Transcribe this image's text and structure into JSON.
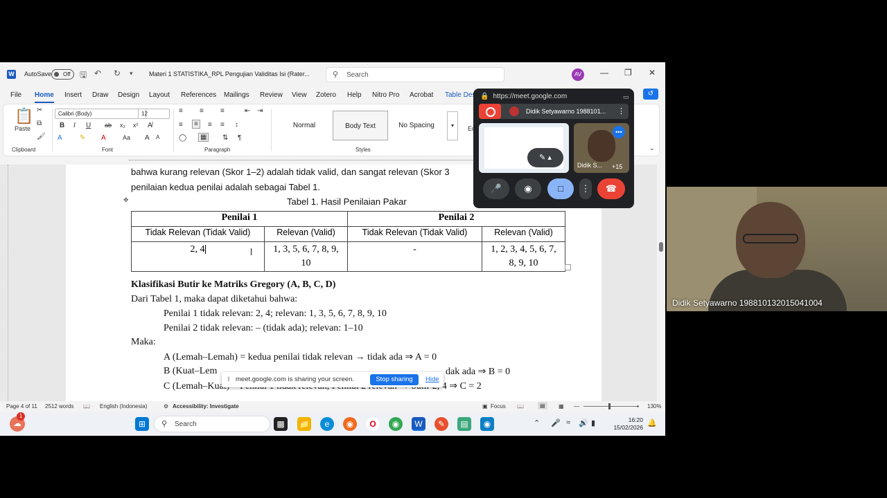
{
  "word": {
    "autosave_label": "AutoSave",
    "autosave_state": "Off",
    "doc_title": "Materi 1 STATISTIKA_RPL Pengujian Validitas Isi (Rater...",
    "search_placeholder": "Search",
    "user_initials": "AV",
    "menu_tabs": [
      "File",
      "Home",
      "Insert",
      "Draw",
      "Design",
      "Layout",
      "References",
      "Mailings",
      "Review",
      "View",
      "Zotero",
      "Help",
      "Nitro Pro",
      "Acrobat",
      "Table Des"
    ],
    "active_tab": "Home",
    "ribbon": {
      "paste_label": "Paste",
      "clipboard_label": "Clipboard",
      "font_name": "Calibri (Body)",
      "font_size": "12",
      "font_label": "Font",
      "paragraph_label": "Paragraph",
      "styles_label": "Styles",
      "styles": [
        "Normal",
        "Body Text",
        "No Spacing"
      ],
      "selected_style": "Body Text",
      "editing_partial": "Ed"
    },
    "document": {
      "line1": "bahwa kurang relevan (Skor 1–2) adalah tidak valid, dan sangat relevan (Skor 3",
      "line2": "penilaian kedua penilai adalah sebagai Tabel 1.",
      "table_caption": "Tabel 1. Hasil Penilaian Pakar",
      "table": {
        "group1": "Penilai 1",
        "group2": "Penilai 2",
        "col1": "Tidak Relevan (Tidak Valid)",
        "col2": "Relevan (Valid)",
        "col3": "Tidak Relevan (Tidak Valid)",
        "col4": "Relevan (Valid)",
        "cell1": "2, 4",
        "cell2a": "1, 3, 5, 6, 7, 8, 9,",
        "cell2b": "10",
        "cell3": "-",
        "cell4a": "1, 2, 3, 4, 5, 6, 7,",
        "cell4b": "8, 9, 10"
      },
      "heading": "Klasifikasi Butir ke Matriks Gregory (A, B, C, D)",
      "p1": "Dari Tabel 1, maka dapat diketahui bahwa:",
      "p2": "Penilai 1 tidak relevan: 2, 4; relevan: 1, 3, 5, 6, 7, 8, 9, 10",
      "p3": "Penilai 2 tidak relevan: – (tidak ada); relevan: 1–10",
      "p4": "Maka:",
      "p5": "A (Lemah–Lemah) = kedua penilai tidak relevan → tidak ada ⇒ A = 0",
      "p6a": "B (Kuat–Lem",
      "p6b": "dak ada ⇒ B = 0",
      "p7": "C (Lemah–Kuat) = Penilai 1 tidak relevan, Penilai 2 relevan → butir 2, 4 ⇒ C = 2"
    },
    "status": {
      "page": "Page 4 of 11",
      "words": "2512 words",
      "language": "English (Indonesia)",
      "accessibility": "Accessibility: Investigate",
      "focus": "Focus",
      "zoom": "130%"
    }
  },
  "sharebar": {
    "message": "meet.google.com is sharing your screen.",
    "stop_label": "Stop sharing",
    "hide_label": "Hide"
  },
  "taskbar": {
    "search_placeholder": "Search",
    "time": "16:20",
    "date": "15/02/2026",
    "notification_count": "1"
  },
  "meet_pip": {
    "url": "https://meet.google.com",
    "presenter_name": "Didik Setyawarno 1988101...",
    "tile_label": "Didik S...",
    "more_count": "+15"
  },
  "webcam": {
    "caption": "Didik Setyawarno 198810132015041004"
  },
  "colors": {
    "word_blue": "#185abd",
    "meet_red": "#ea4335",
    "meet_blue": "#1a73e8"
  }
}
